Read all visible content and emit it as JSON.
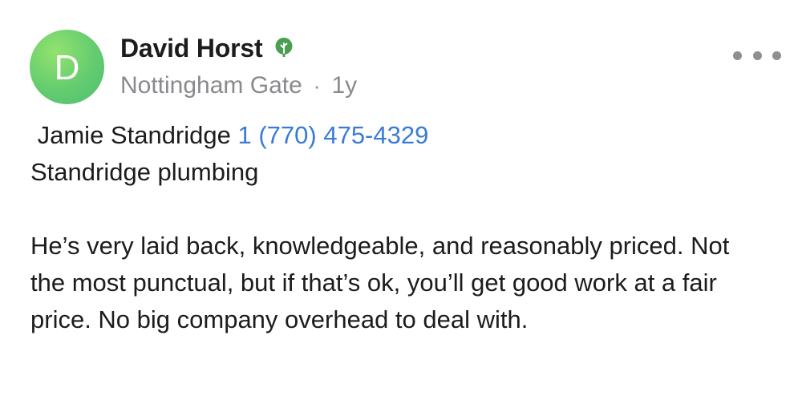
{
  "author": {
    "avatar_letter": "D",
    "name": "David Horst",
    "badge_icon": "tree-badge-icon",
    "neighborhood": "Nottingham Gate",
    "separator": "·",
    "age": "1y"
  },
  "more_icon": "more-horizontal-icon",
  "post": {
    "contact_name": " Jamie Standridge",
    "phone": "1 (770) 475-4329",
    "business": "Standridge plumbing",
    "review": "He’s very laid back, knowledgeable, and reasonably priced. Not the most punctual, but if that’s ok, you’ll get good work at a fair price. No big company overhead to deal with."
  },
  "colors": {
    "link": "#3a7bd5",
    "meta": "#8a8a8e",
    "avatar": "#63cc6f",
    "badge": "#4a9e4f"
  }
}
